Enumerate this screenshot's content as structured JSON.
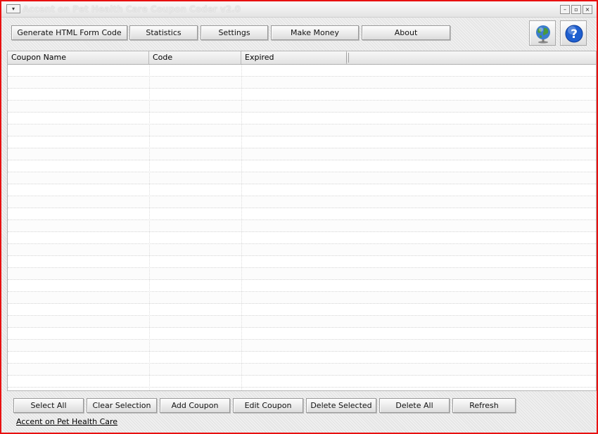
{
  "window": {
    "title": "Accent on Pet Health Care Coupon Coder v2.0",
    "frame_color": "#e81010"
  },
  "toolbar": {
    "buttons": [
      {
        "label": "Generate HTML Form Code"
      },
      {
        "label": "Statistics"
      },
      {
        "label": "Settings"
      },
      {
        "label": "Make Money"
      },
      {
        "label": "About"
      }
    ],
    "icons": [
      "globe-icon",
      "help-icon"
    ]
  },
  "table": {
    "columns": [
      "Coupon Name",
      "Code",
      "Expired"
    ],
    "rows": []
  },
  "actions": {
    "buttons": [
      {
        "label": "Select All"
      },
      {
        "label": "Clear Selection"
      },
      {
        "label": "Add Coupon"
      },
      {
        "label": "Edit Coupon"
      },
      {
        "label": "Delete Selected"
      },
      {
        "label": "Delete All"
      },
      {
        "label": "Refresh"
      }
    ]
  },
  "footer": {
    "link_text": "Accent on Pet Health Care"
  },
  "colors": {
    "help_icon_blue": "#1f5fcf",
    "globe_blue": "#3c7dcc",
    "globe_green": "#4a9a3a"
  }
}
